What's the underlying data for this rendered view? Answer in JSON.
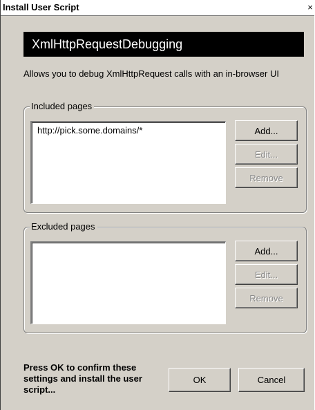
{
  "window": {
    "title": "Install User Script",
    "close_glyph": "×"
  },
  "script": {
    "name": "XmlHttpRequestDebugging",
    "description": "Allows you to debug XmlHttpRequest calls with an in-browser UI"
  },
  "included": {
    "label": "Included pages",
    "items": [
      "http://pick.some.domains/*"
    ],
    "add_label": "Add...",
    "edit_label": "Edit...",
    "remove_label": "Remove"
  },
  "excluded": {
    "label": "Excluded pages",
    "items": [],
    "add_label": "Add...",
    "edit_label": "Edit...",
    "remove_label": "Remove"
  },
  "footer": {
    "confirm_text": "Press OK to confirm these settings and install the user script...",
    "ok_label": "OK",
    "cancel_label": "Cancel"
  },
  "colors": {
    "dialog_bg": "#d4d0c8",
    "name_banner_bg": "#000000",
    "name_banner_fg": "#ffffff",
    "disabled_text": "#8a8a8a"
  },
  "icons": {
    "close": "close-icon"
  }
}
